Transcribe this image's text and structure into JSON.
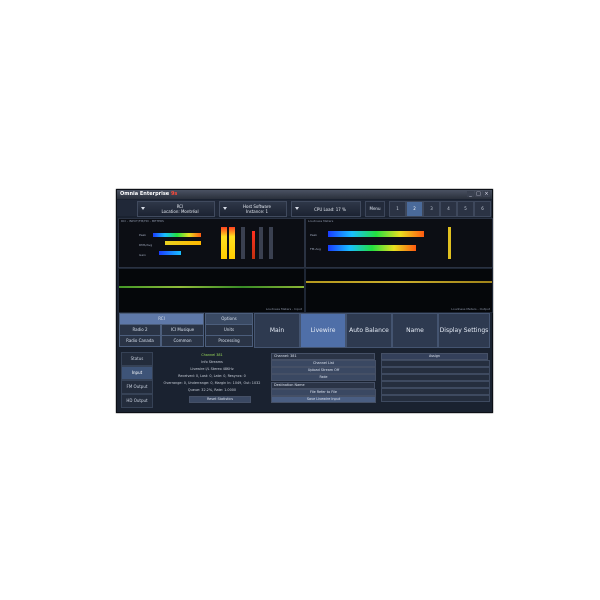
{
  "window": {
    "title_prefix": "Omnia Enterprise",
    "title_suffix": "9s",
    "controls": [
      "_",
      "□",
      "×"
    ]
  },
  "topbar": {
    "preset_select": {
      "line1": "RCI",
      "line2": "Location: Montréal"
    },
    "instance_select": {
      "line1": "Host Software",
      "line2": "Instance: 1"
    },
    "cpu_select": {
      "line1": "CPU Load: 17 %"
    },
    "menu_label": "Menu",
    "presets": [
      "1",
      "2",
      "3",
      "4",
      "5",
      "6"
    ],
    "active_preset": "2"
  },
  "panels": {
    "left_label": "RCI - INPUT/FM/HD - METERS",
    "right_label": "Loudness Meters",
    "left_meter_labels": [
      "Peak",
      "RMS/Avg",
      "Gain"
    ],
    "right_meter_labels": [
      "Peak",
      "FM-Avg"
    ],
    "left_scope_caption": "Loudness Meters - Input",
    "right_scope_caption": "Loudness Meters - Output"
  },
  "nav": {
    "grid": [
      {
        "label": "RCI"
      },
      {
        "label": "Options"
      },
      {
        "label": "Radio 2"
      },
      {
        "label": "ICI Musique"
      },
      {
        "label": "Units"
      },
      {
        "label": "Radio Canada"
      },
      {
        "label": "Common"
      },
      {
        "label": "Processing"
      }
    ],
    "tabs": [
      {
        "label": "Main"
      },
      {
        "label": "Livewire"
      },
      {
        "label": "Auto Balance"
      },
      {
        "label": "Name"
      },
      {
        "label": "Display Settings"
      }
    ],
    "active_tab": "Livewire"
  },
  "sidebar": {
    "items": [
      "Status",
      "Input",
      "FM Output",
      "HD Output"
    ],
    "active": "Input"
  },
  "status": {
    "channel": "Channel 381",
    "lines": [
      "Info Streams",
      "Livewire I/L Stereo 48KHz",
      "Received: 0, Lost: 0, Late: 0, Resyncs: 0",
      "Overrange: 0, Underrange: 0, Margin In: 1049, Out: 1032",
      "Queue: 32.2%, Rate: 1.0000"
    ],
    "reset_button": "Reset Statistics"
  },
  "livewire": {
    "channel_field": "Channel: 381",
    "channel_list_button": "Channel List",
    "stream_select_button": "Upload Stream Off",
    "fade_button": "Fade",
    "destination_label": "Destination Name",
    "file_ref_button": "File Refer to File",
    "save_button": "Save Livewire Input"
  },
  "assign": {
    "header": "Assign"
  }
}
